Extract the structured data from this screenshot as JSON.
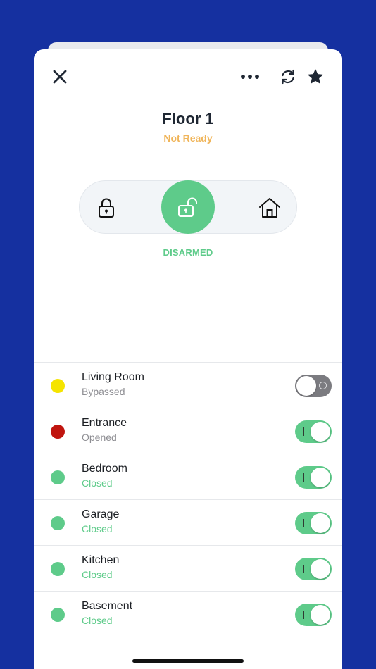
{
  "header": {
    "title": "Floor 1",
    "readiness": "Not Ready",
    "icons": {
      "close": "close-icon",
      "more": "more-icon",
      "refresh": "refresh-icon",
      "favorite": "star-icon"
    }
  },
  "modes": {
    "options": [
      {
        "icon": "lock-closed-icon",
        "mode": "away"
      },
      {
        "icon": "lock-open-icon",
        "mode": "disarm",
        "selected": true
      },
      {
        "icon": "home-icon",
        "mode": "stay"
      }
    ],
    "status": "DISARMED"
  },
  "zones": [
    {
      "name": "Living Room",
      "state": "Bypassed",
      "dot_color": "#f5e400",
      "state_color": "#8e8e93",
      "enabled": false
    },
    {
      "name": "Entrance",
      "state": "Opened",
      "dot_color": "#c0150f",
      "state_color": "#8e8e93",
      "enabled": true
    },
    {
      "name": "Bedroom",
      "state": "Closed",
      "dot_color": "#5ecb8a",
      "state_color": "#5ecb8a",
      "enabled": true
    },
    {
      "name": "Garage",
      "state": "Closed",
      "dot_color": "#5ecb8a",
      "state_color": "#5ecb8a",
      "enabled": true
    },
    {
      "name": "Kitchen",
      "state": "Closed",
      "dot_color": "#5ecb8a",
      "state_color": "#5ecb8a",
      "enabled": true
    },
    {
      "name": "Basement",
      "state": "Closed",
      "dot_color": "#5ecb8a",
      "state_color": "#5ecb8a",
      "enabled": true
    }
  ],
  "colors": {
    "background": "#1530a0",
    "accent_green": "#5ecb8a",
    "warning": "#f0b55a",
    "toggle_off": "#7b7b80"
  }
}
